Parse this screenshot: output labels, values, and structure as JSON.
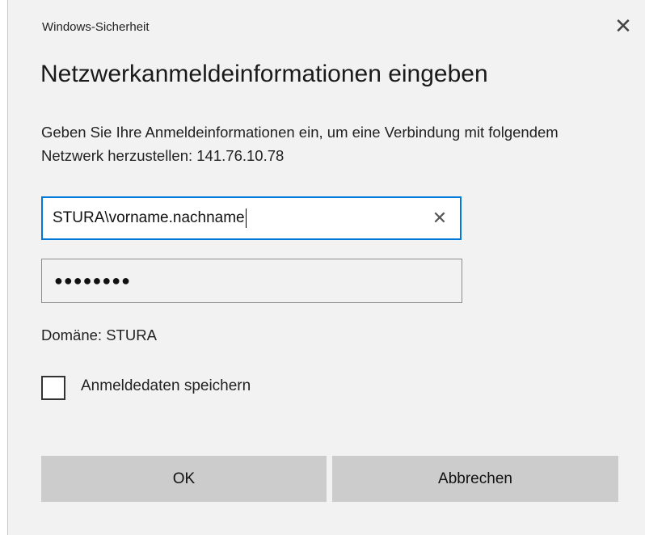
{
  "window": {
    "title": "Windows-Sicherheit",
    "close_glyph": "✕"
  },
  "heading": "Netzwerkanmeldeinformationen eingeben",
  "description": "Geben Sie Ihre Anmeldeinformationen ein, um eine Verbindung mit folgendem Netzwerk herzustellen: 141.76.10.78",
  "username": {
    "value": "STURA\\vorname.nachname",
    "clear_glyph": "✕"
  },
  "password": {
    "masked_value": "●●●●●●●●"
  },
  "domain_text": "Domäne: STURA",
  "remember": {
    "label": "Anmeldedaten speichern",
    "checked": false
  },
  "buttons": {
    "ok_label": "OK",
    "cancel_label": "Abbrechen"
  },
  "colors": {
    "focus_border": "#0078d7",
    "dialog_bg": "#f2f2f2",
    "button_bg": "#cccccc"
  }
}
